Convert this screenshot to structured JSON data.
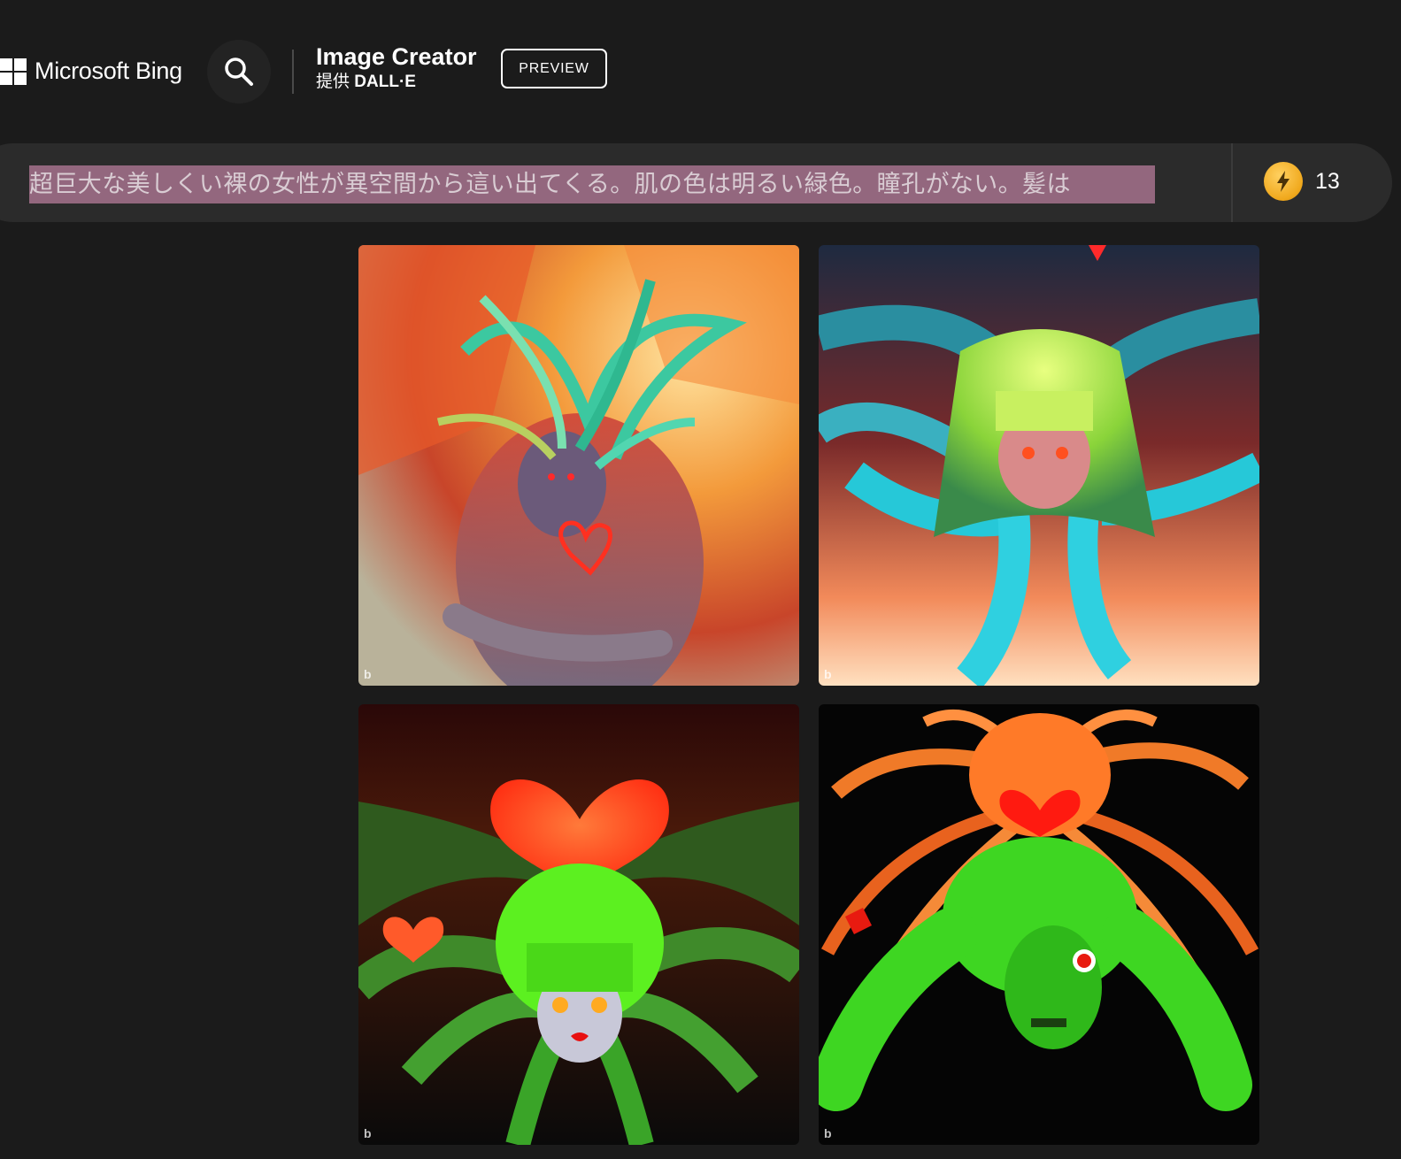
{
  "header": {
    "brand": "Microsoft Bing",
    "app_title": "Image Creator",
    "app_subtitle_prefix": "提供",
    "app_subtitle_model": "DALL·E",
    "preview_badge": "PREVIEW"
  },
  "prompt": {
    "value": "超巨大な美しくい裸の女性が異空間から這い出てくる。肌の色は明るい緑色。瞳孔がない。髪は"
  },
  "boosts": {
    "count": "13",
    "icon": "lightning-coin-icon"
  },
  "images": [
    {
      "alt_icon": "generated-image-1",
      "watermark": "b"
    },
    {
      "alt_icon": "generated-image-2",
      "watermark": "b"
    },
    {
      "alt_icon": "generated-image-3",
      "watermark": "b"
    },
    {
      "alt_icon": "generated-image-4",
      "watermark": "b"
    }
  ],
  "colors": {
    "background": "#1b1b1b",
    "prompt_bar": "#2b2b2b",
    "selection_highlight": "#93677e",
    "boost_coin": "#f0a81c"
  }
}
